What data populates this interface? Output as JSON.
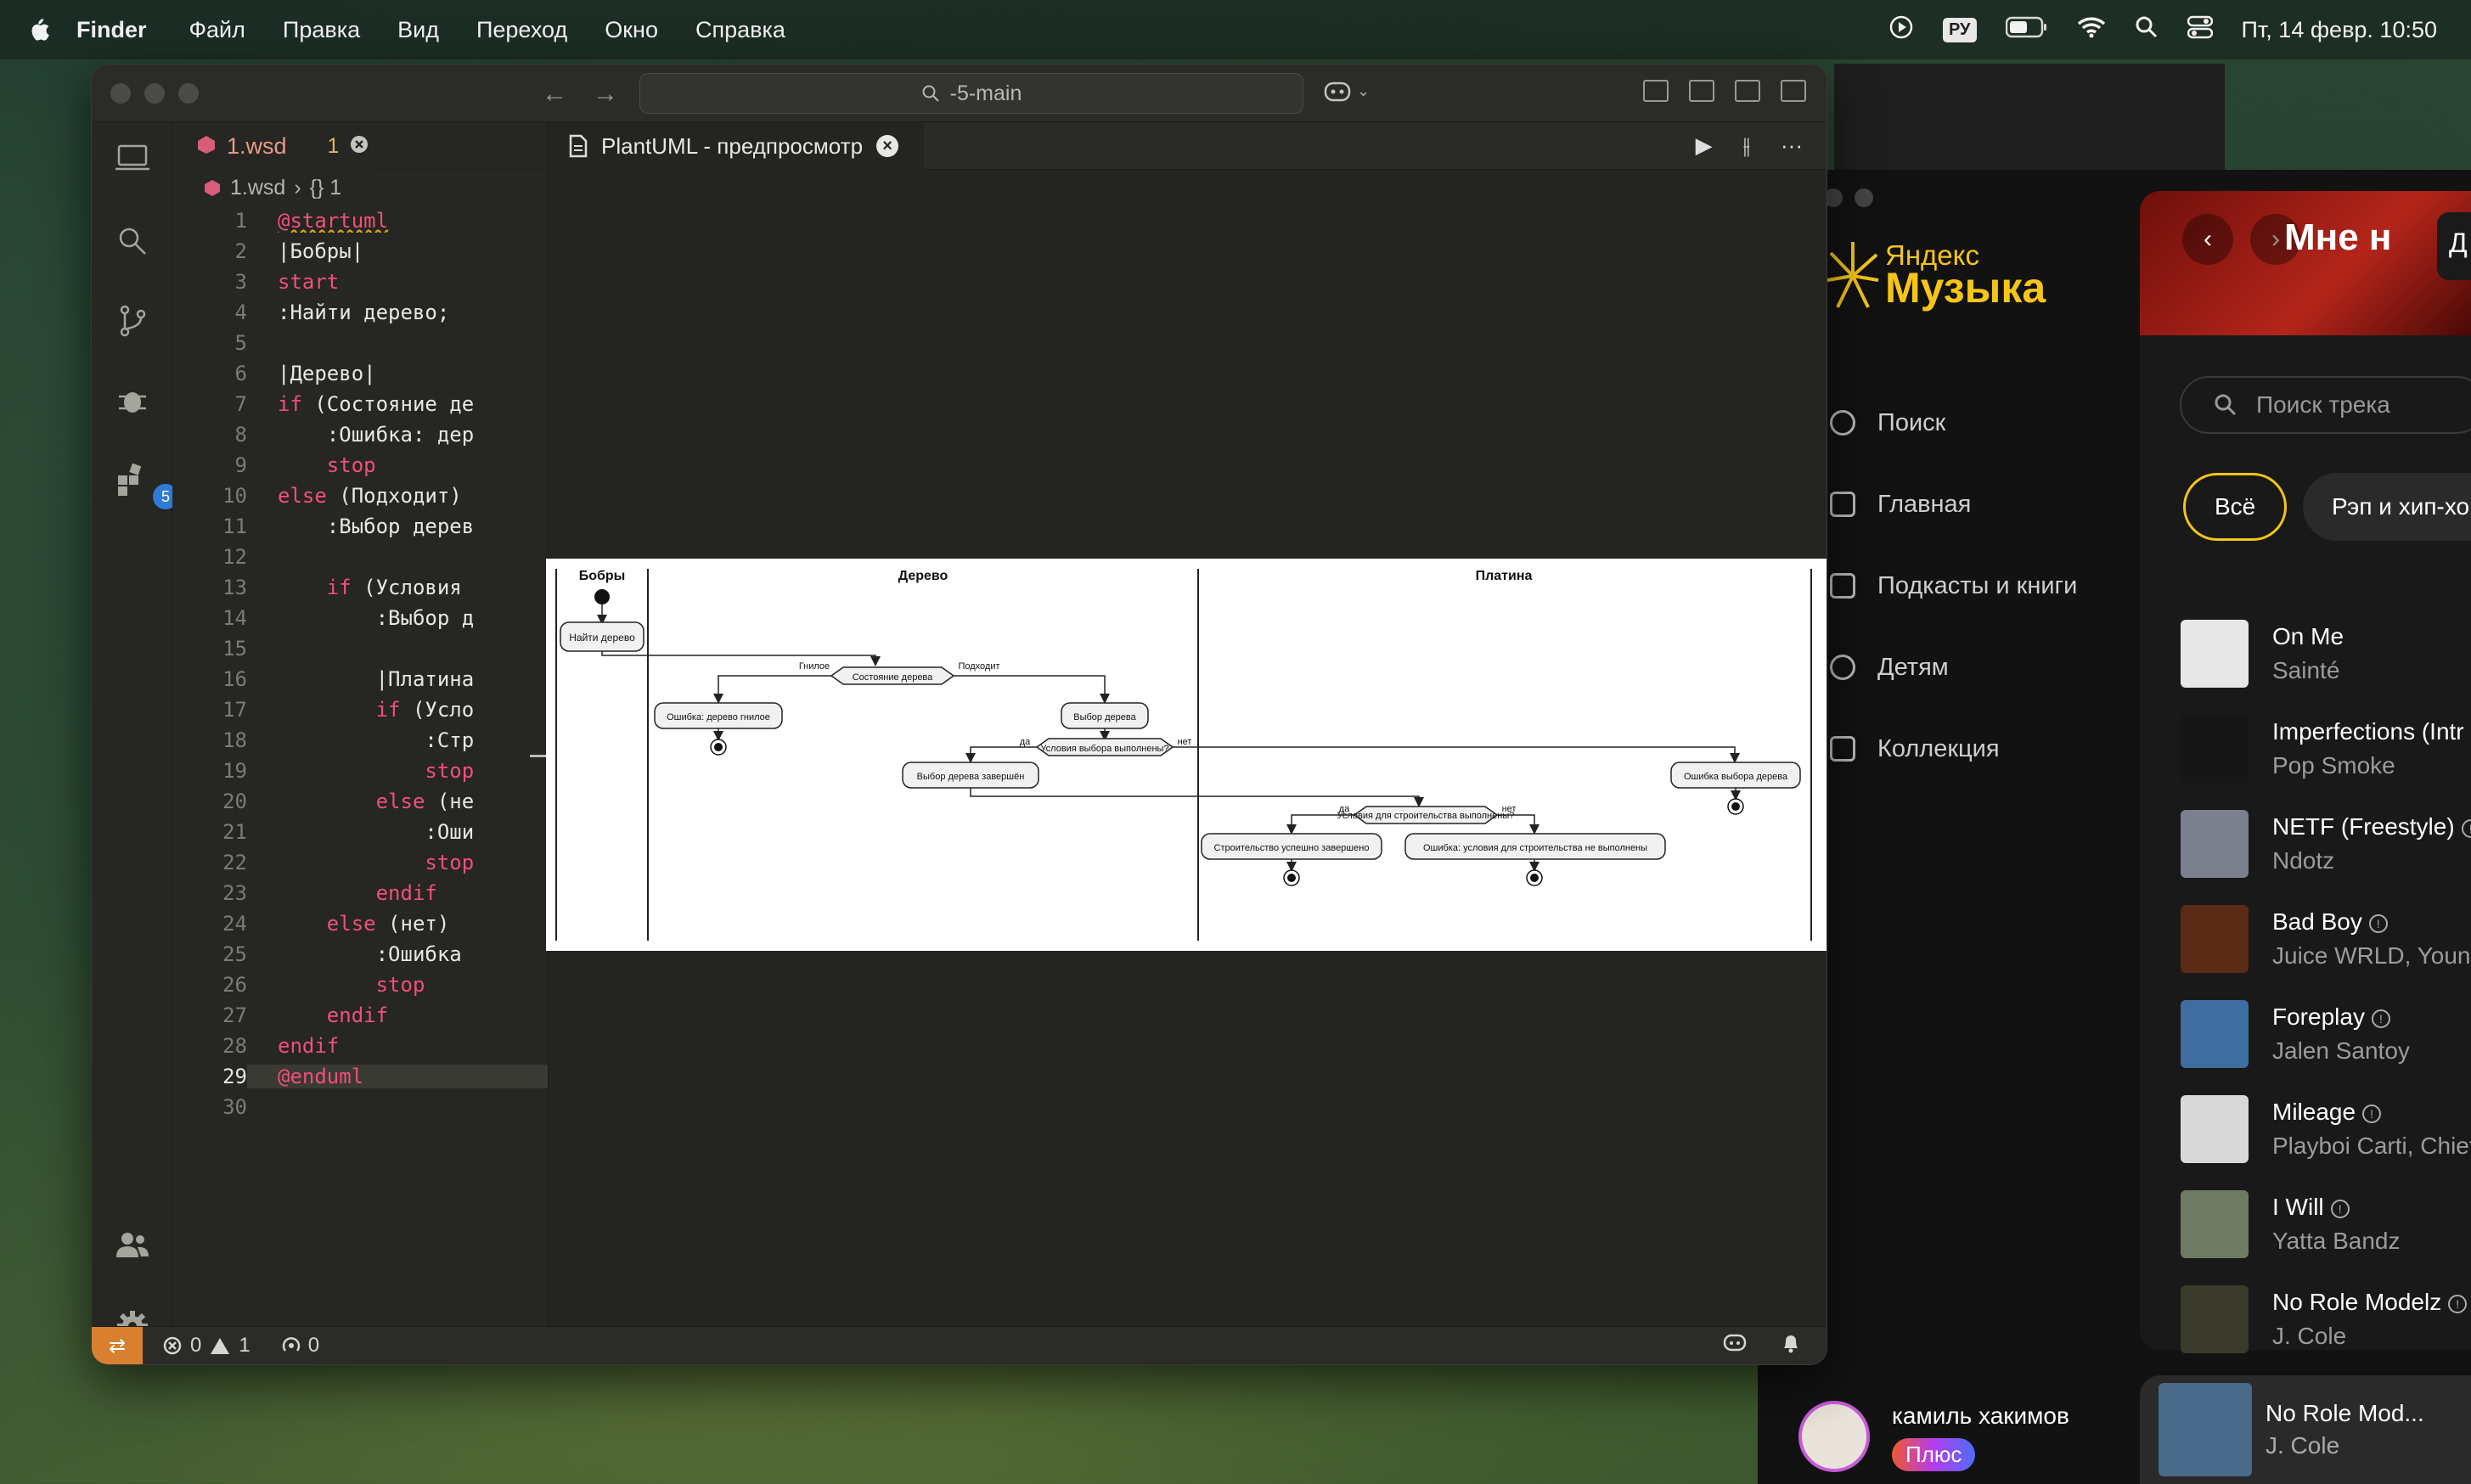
{
  "menubar": {
    "app": "Finder",
    "items": [
      "Файл",
      "Правка",
      "Вид",
      "Переход",
      "Окно",
      "Справка"
    ],
    "input_source": "РУ",
    "clock": "Пт, 14 февр.  10:50"
  },
  "vscode": {
    "command_center": "-5-main",
    "activity_badge": "5",
    "tab": {
      "file": "1.wsd",
      "problems": "1"
    },
    "breadcrumb": {
      "file": "1.wsd",
      "symbol": "{} 1"
    },
    "preview_tab": "PlantUML - предпросмотр",
    "code_lines": [
      "@startuml",
      "|Бобры|",
      "start",
      ":Найти дерево;",
      "",
      "|Дерево|",
      "if (Состояние де",
      "    :Ошибка: дер",
      "    stop",
      "else (Подходит)",
      "    :Выбор дерев",
      "",
      "    if (Условия",
      "        :Выбор д",
      "",
      "        |Платина",
      "        if (Усло",
      "            :Стр",
      "            stop",
      "        else (не",
      "            :Оши",
      "            stop",
      "        endif",
      "    else (нет)",
      "        :Ошибка",
      "        stop",
      "    endif",
      "endif",
      "@enduml",
      ""
    ],
    "line_numbers": [
      "1",
      "2",
      "3",
      "4",
      "5",
      "6",
      "7",
      "8",
      "9",
      "10",
      "11",
      "12",
      "13",
      "14",
      "15",
      "16",
      "17",
      "18",
      "19",
      "20",
      "21",
      "22",
      "23",
      "24",
      "25",
      "26",
      "27",
      "28",
      "29",
      "30"
    ],
    "status": {
      "errors": "0",
      "warnings": "1",
      "ports": "0"
    }
  },
  "diagram": {
    "lanes": [
      "Бобры",
      "Дерево",
      "Платина"
    ],
    "nodes": {
      "find_tree": "Найти дерево",
      "tree_state": "Состояние дерева",
      "rotten_label": "Гнилое",
      "fits_label": "Подходит",
      "error_rotten": "Ошибка: дерево гнилое",
      "choose_tree": "Выбор дерева",
      "choose_conditions": "Условия выбора выполнены?",
      "yes1": "да",
      "no1": "нет",
      "choose_done": "Выбор дерева завершён",
      "choose_error": "Ошибка выбора дерева",
      "build_conditions": "Условия для строительства выполнены?",
      "yes2": "да",
      "no2": "нет",
      "build_done": "Строительство успешно завершено",
      "build_error": "Ошибка: условия для строительства не выполнены"
    }
  },
  "music": {
    "logo_small": "Яндекс",
    "logo_big": "Музыка",
    "nav": [
      "Поиск",
      "Главная",
      "Подкасты и книги",
      "Детям",
      "Коллекция"
    ],
    "hero_title": "Мне н",
    "hero_tag": "Д",
    "search_placeholder": "Поиск трека",
    "chips": [
      "Всё",
      "Рэп и хип-хоп"
    ],
    "tracks": [
      {
        "title": "On Me",
        "artist": "Sainté",
        "explicit": false,
        "color": "#e7e7e7"
      },
      {
        "title": "Imperfections (Intr",
        "artist": "Pop Smoke",
        "explicit": false,
        "color": "#161616"
      },
      {
        "title": "NETF (Freestyle)",
        "artist": "Ndotz",
        "explicit": true,
        "color": "#7b7f8e"
      },
      {
        "title": "Bad Boy",
        "artist": "Juice WRLD, Young",
        "explicit": true,
        "color": "#5a2a14"
      },
      {
        "title": "Foreplay",
        "artist": "Jalen Santoy",
        "explicit": true,
        "color": "#3f6da0"
      },
      {
        "title": "Mileage",
        "artist": "Playboi Carti, Chief",
        "explicit": true,
        "color": "#d9d9d9"
      },
      {
        "title": "I Will",
        "artist": "Yatta Bandz",
        "explicit": true,
        "color": "#6f7a63"
      },
      {
        "title": "No Role Modelz",
        "artist": "J. Cole",
        "explicit": true,
        "color": "#3a3a2a"
      }
    ],
    "user": "камиль хакимов",
    "plus": "Плюс",
    "player": {
      "title": "No Role Mod...",
      "artist": "J. Cole"
    }
  }
}
